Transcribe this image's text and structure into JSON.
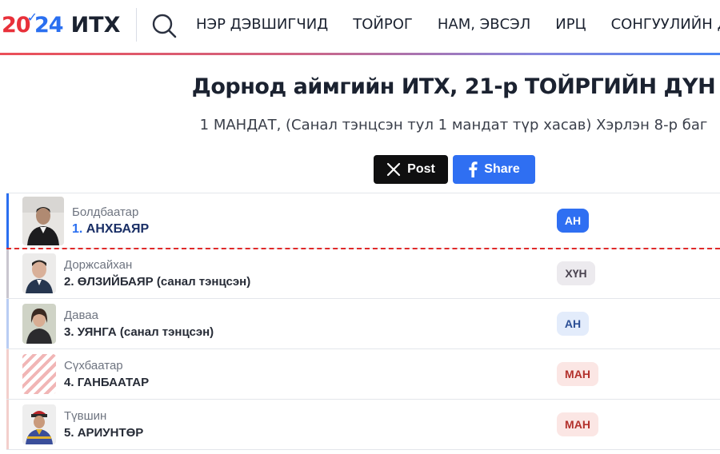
{
  "header": {
    "logo_year_start": "20",
    "logo_year_end": "24",
    "logo_org": "ИТХ",
    "nav": [
      "НЭР ДЭВШИГЧИД",
      "ТОЙРОГ",
      "НАМ, ЭВСЭЛ",
      "ИРЦ",
      "СОНГУУЛИЙН Д"
    ]
  },
  "page": {
    "title": "Дорнод аймгийн ИТХ, 21-р ТОЙРГИЙН ДҮН",
    "subtitle": "1 МАНДАТ, (Санал тэнцсэн тул 1 мандат түр хасав) Хэрлэн 8-р баг"
  },
  "share": {
    "post_label": "Post",
    "share_label": "Share"
  },
  "candidates": [
    {
      "patronym": "Болдбаатар",
      "rank": "1.",
      "name": "АНХБАЯР",
      "party": "АН"
    },
    {
      "patronym": "Доржсайхан",
      "rank": "2.",
      "name": "ӨЛЗИЙБАЯР (санал тэнцсэн)",
      "party": "ХҮН"
    },
    {
      "patronym": "Даваа",
      "rank": "3.",
      "name": "УЯНГА (санал тэнцсэн)",
      "party": "АН"
    },
    {
      "patronym": "Сүхбаатар",
      "rank": "4.",
      "name": "ГАНБААТАР",
      "party": "МАН"
    },
    {
      "patronym": "Түвшин",
      "rank": "5.",
      "name": "АРИУНТӨР",
      "party": "МАН"
    }
  ],
  "colors": {
    "an_solid": "#2f6ff2",
    "an_light": "#e3ecfb",
    "hun_light": "#eceaee",
    "man_light": "#fbe6e4",
    "man_text": "#b3312c",
    "winner_bar": "#2a6ff0",
    "cutoff_line": "#e02a2a",
    "x_button": "#0f0f10"
  },
  "icons": [
    "search-icon",
    "x-logo-icon",
    "facebook-icon",
    "candidate-photo",
    "placeholder-photo"
  ]
}
